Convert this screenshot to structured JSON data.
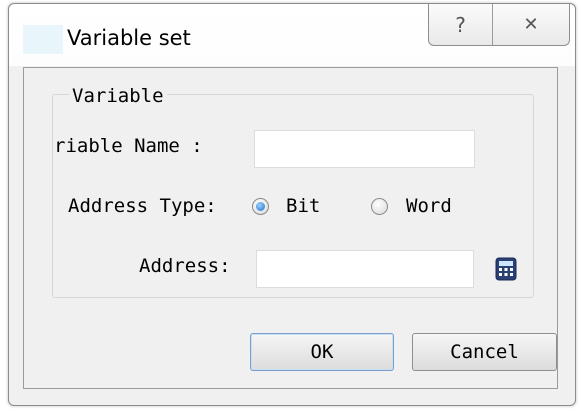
{
  "window": {
    "title": "Variable set",
    "help_glyph": "?",
    "close_glyph": "✕"
  },
  "group": {
    "title": "Variable"
  },
  "variable_name": {
    "label": "riable Name :",
    "value": ""
  },
  "address_type": {
    "label": "Address Type:",
    "selected": "Bit",
    "options": [
      "Bit",
      "Word"
    ]
  },
  "address": {
    "label": "Address:",
    "value": "",
    "picker_icon": "calculator-icon"
  },
  "buttons": {
    "ok": "OK",
    "cancel": "Cancel"
  }
}
